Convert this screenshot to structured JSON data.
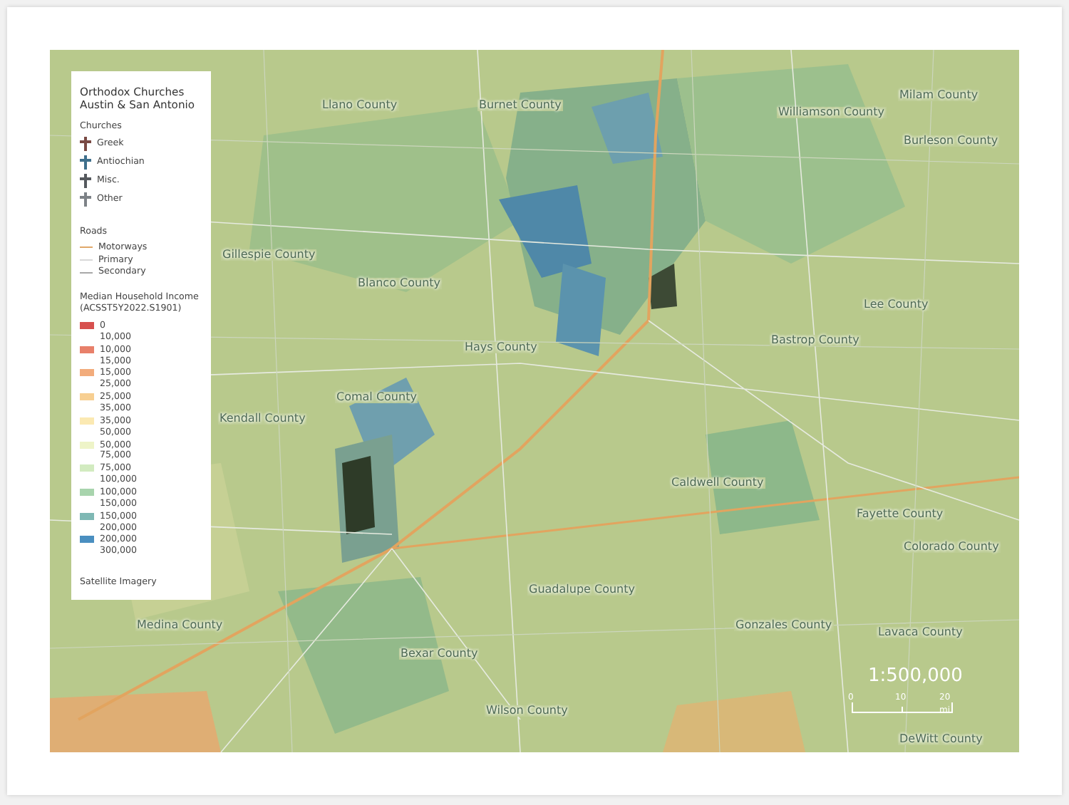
{
  "legend": {
    "title": "Orthodox Churches",
    "subtitle": "Austin & San Antonio",
    "churches": {
      "heading": "Churches",
      "items": [
        {
          "label": "Greek",
          "color": "#7a4a44"
        },
        {
          "label": "Antiochian",
          "color": "#3f6f8c"
        },
        {
          "label": "Misc.",
          "color": "#55595e"
        },
        {
          "label": "Other",
          "color": "#7d8287"
        }
      ]
    },
    "roads": {
      "heading": "Roads",
      "items": [
        {
          "label": "Motorways",
          "color": "#e0a86a"
        },
        {
          "label": "Primary",
          "color": "#d8d8d8"
        },
        {
          "label": "Secondary",
          "color": "#a8a8a8"
        }
      ]
    },
    "income": {
      "heading": "Median Household Income",
      "subheading": "(ACSST5Y2022.S1901)",
      "items": [
        {
          "from": "0",
          "to": "10,000",
          "color": "#d7504e"
        },
        {
          "from": "10,000",
          "to": "15,000",
          "color": "#e8806a"
        },
        {
          "from": "15,000",
          "to": "25,000",
          "color": "#f2ac7c"
        },
        {
          "from": "25,000",
          "to": "35,000",
          "color": "#f7cf92"
        },
        {
          "from": "35,000",
          "to": "50,000",
          "color": "#fbe9b2"
        },
        {
          "from": "50,000",
          "to": "75,000",
          "color": "#eef4c8"
        },
        {
          "from": "75,000",
          "to": "100,000",
          "color": "#d2ebc0"
        },
        {
          "from": "100,000",
          "to": "150,000",
          "color": "#a8d4ad"
        },
        {
          "from": "150,000",
          "to": "200,000",
          "color": "#7fb8b4"
        },
        {
          "from": "200,000",
          "to": "300,000",
          "color": "#4a8fc0"
        }
      ]
    },
    "footer": "Satellite Imagery"
  },
  "map": {
    "counties": [
      "Llano County",
      "Burnet County",
      "Williamson County",
      "Milam County",
      "Burleson County",
      "Gillespie County",
      "Blanco County",
      "Hays County",
      "Lee County",
      "Bastrop County",
      "Kendall County",
      "Comal County",
      "Caldwell County",
      "Fayette County",
      "Colorado County",
      "Guadalupe County",
      "Medina County",
      "Bexar County",
      "Gonzales County",
      "Lavaca County",
      "Wilson County",
      "DeWitt County"
    ]
  },
  "scale": {
    "ratio": "1:500,000",
    "ticks": [
      "0",
      "10",
      "20 mi"
    ]
  }
}
